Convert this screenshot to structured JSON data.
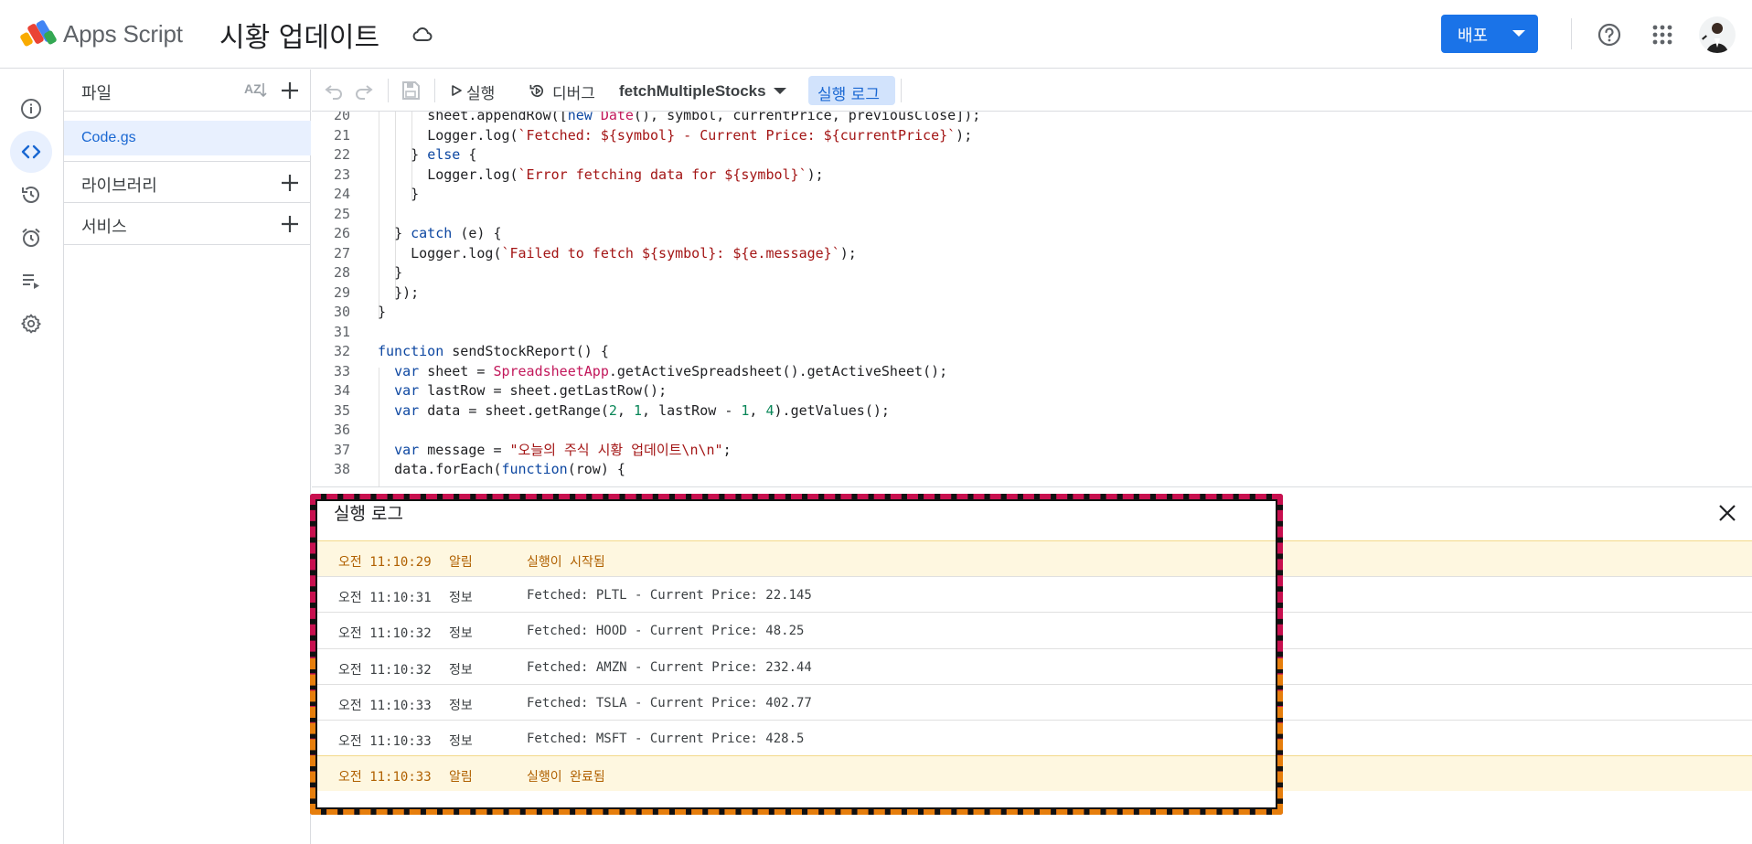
{
  "header": {
    "app_name": "Apps Script",
    "project_title": "시황 업데이트",
    "deploy_label": "배포"
  },
  "files_panel": {
    "files_label": "파일",
    "active_file": "Code.gs",
    "libraries_label": "라이브러리",
    "services_label": "서비스"
  },
  "toolbar": {
    "run_label": "실행",
    "debug_label": "디버그",
    "function_name": "fetchMultipleStocks",
    "log_label": "실행 로그"
  },
  "editor": {
    "lines": [
      {
        "n": "20",
        "code": "      sheet.appendRow([new Date(), symbol, currentPrice, previousClose]);"
      },
      {
        "n": "21",
        "code": "      Logger.log(`Fetched: ${symbol} - Current Price: ${currentPrice}`);"
      },
      {
        "n": "22",
        "code": "    } else {"
      },
      {
        "n": "23",
        "code": "      Logger.log(`Error fetching data for ${symbol}`);"
      },
      {
        "n": "24",
        "code": "    }"
      },
      {
        "n": "25",
        "code": ""
      },
      {
        "n": "26",
        "code": "  } catch (e) {"
      },
      {
        "n": "27",
        "code": "    Logger.log(`Failed to fetch ${symbol}: ${e.message}`);"
      },
      {
        "n": "28",
        "code": "  }"
      },
      {
        "n": "29",
        "code": "  });"
      },
      {
        "n": "30",
        "code": "}"
      },
      {
        "n": "31",
        "code": ""
      },
      {
        "n": "32",
        "code": "function sendStockReport() {"
      },
      {
        "n": "33",
        "code": "  var sheet = SpreadsheetApp.getActiveSpreadsheet().getActiveSheet();"
      },
      {
        "n": "34",
        "code": "  var lastRow = sheet.getLastRow();"
      },
      {
        "n": "35",
        "code": "  var data = sheet.getRange(2, 1, lastRow - 1, 4).getValues();"
      },
      {
        "n": "36",
        "code": ""
      },
      {
        "n": "37",
        "code": "  var message = \"오늘의 주식 시황 업데이트\\n\\n\";"
      },
      {
        "n": "38",
        "code": "  data.forEach(function(row) {"
      }
    ]
  },
  "log": {
    "title": "실행 로그",
    "rows": [
      {
        "time": "오전 11:10:29",
        "level": "알림",
        "message": "실행이 시작됨",
        "type": "notice"
      },
      {
        "time": "오전 11:10:31",
        "level": "정보",
        "message": "Fetched: PLTL - Current Price: 22.145",
        "type": "info"
      },
      {
        "time": "오전 11:10:32",
        "level": "정보",
        "message": "Fetched: HOOD - Current Price: 48.25",
        "type": "info"
      },
      {
        "time": "오전 11:10:32",
        "level": "정보",
        "message": "Fetched: AMZN - Current Price: 232.44",
        "type": "info"
      },
      {
        "time": "오전 11:10:33",
        "level": "정보",
        "message": "Fetched: TSLA - Current Price: 402.77",
        "type": "info"
      },
      {
        "time": "오전 11:10:33",
        "level": "정보",
        "message": "Fetched: MSFT - Current Price: 428.5",
        "type": "info"
      },
      {
        "time": "오전 11:10:33",
        "level": "알림",
        "message": "실행이 완료됨",
        "type": "notice"
      }
    ]
  },
  "colors": {
    "accent": "#1a73e8",
    "notice_bg": "#fef7e0",
    "notice_text": "#b06000",
    "highlight_frame": "#c8104f",
    "highlight_frame_lower": "#e67e0c"
  },
  "icons": {
    "rail": [
      "info-icon",
      "code-icon",
      "history-icon",
      "alarm-icon",
      "executions-icon",
      "settings-icon"
    ]
  }
}
